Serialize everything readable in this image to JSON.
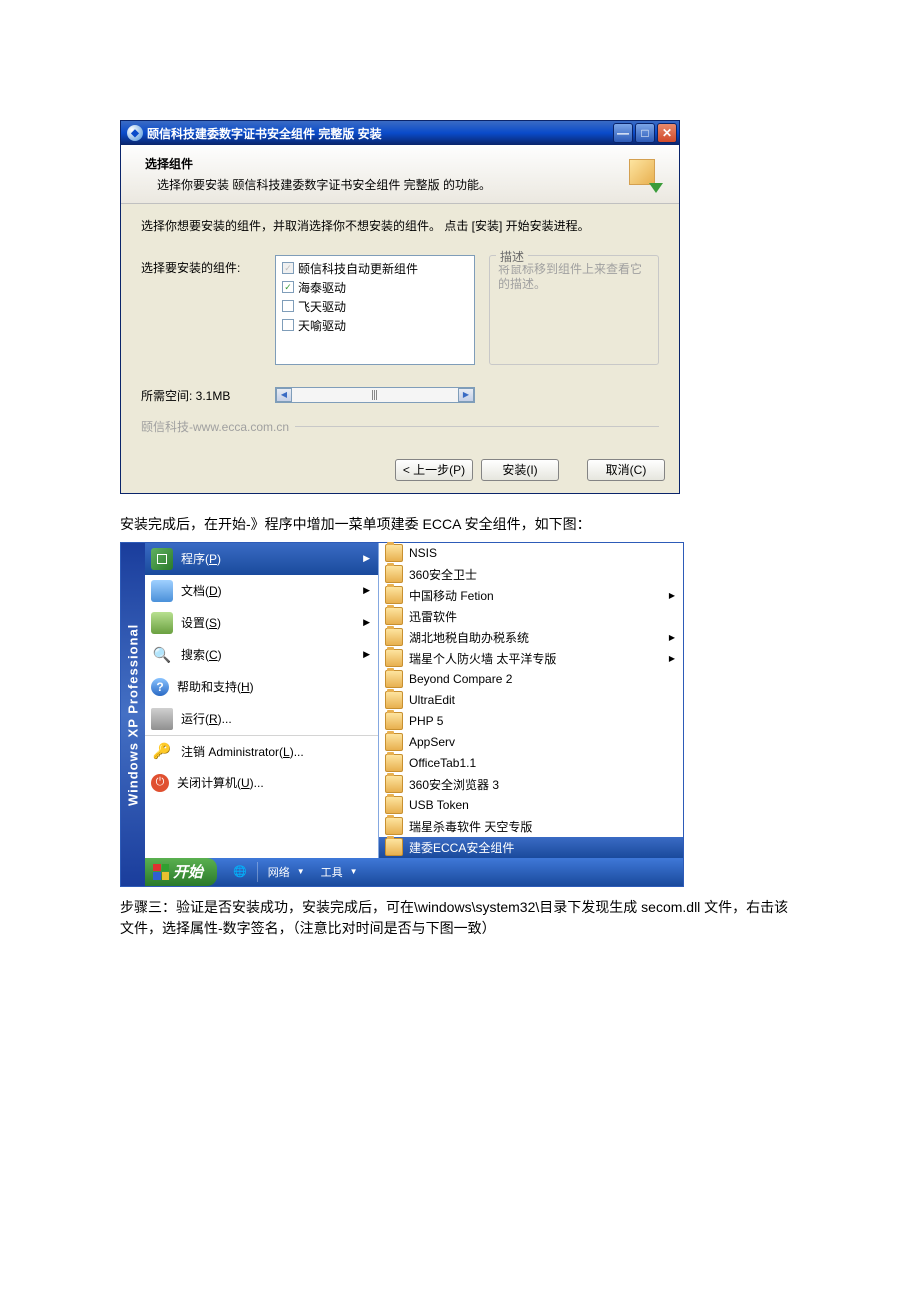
{
  "dialog": {
    "title": "颐信科技建委数字证书安全组件 完整版 安装",
    "header_title": "选择组件",
    "header_sub": "选择你要安装 颐信科技建委数字证书安全组件 完整版 的功能。",
    "instruction": "选择你想要安装的组件，并取消选择你不想安装的组件。 点击 [安装] 开始安装进程。",
    "list_label": "选择要安装的组件:",
    "components": [
      {
        "label": "颐信科技自动更新组件",
        "checked": true,
        "disabled": true
      },
      {
        "label": "海泰驱动",
        "checked": true,
        "disabled": false
      },
      {
        "label": "飞天驱动",
        "checked": false,
        "disabled": false
      },
      {
        "label": "天喻驱动",
        "checked": false,
        "disabled": false
      }
    ],
    "desc_legend": "描述",
    "desc_text": "将鼠标移到组件上来查看它的描述。",
    "space_label": "所需空间: 3.1MB",
    "footer_text": "颐信科技-www.ecca.com.cn",
    "btn_back": "< 上一步(P)",
    "btn_install": "安装(I)",
    "btn_cancel": "取消(C)"
  },
  "caption1": "安装完成后，在开始-》程序中增加一菜单项建委 ECCA 安全组件，如下图：",
  "caption2": "步骤三：验证是否安装成功，安装完成后，可在\\windows\\system32\\目录下发现生成 secom.dll 文件，右击该文件，选择属性-数字签名，（注意比对时间是否与下图一致）",
  "startmenu": {
    "sideband": "Windows XP Professional",
    "left": [
      {
        "label": "程序(P)",
        "icon": "icn-prog",
        "arrow": true,
        "hi": true
      },
      {
        "label": "文档(D)",
        "icon": "icn-doc",
        "arrow": true
      },
      {
        "label": "设置(S)",
        "icon": "icn-set",
        "arrow": true
      },
      {
        "label": "搜索(C)",
        "icon": "icn-sea",
        "arrow": true
      },
      {
        "label": "帮助和支持(H)",
        "icon": "icn-help"
      },
      {
        "label": "运行(R)...",
        "icon": "icn-run"
      },
      {
        "label": "注销 Administrator(L)...",
        "icon": "icn-logoff",
        "sep": true
      },
      {
        "label": "关闭计算机(U)...",
        "icon": "icn-shut"
      }
    ],
    "right": [
      "NSIS",
      "360安全卫士",
      "中国移动 Fetion",
      "迅雷软件",
      "湖北地税自助办税系统",
      "瑞星个人防火墙 太平洋专版",
      "Beyond Compare 2",
      "UltraEdit",
      "PHP 5",
      "AppServ",
      "OfficeTab1.1",
      "360安全浏览器 3",
      "USB Token",
      "瑞星杀毒软件 天空专版"
    ],
    "right_hi": "建委ECCA安全组件"
  },
  "taskbar": {
    "start": "开始",
    "items": [
      "网络",
      "工具"
    ]
  }
}
